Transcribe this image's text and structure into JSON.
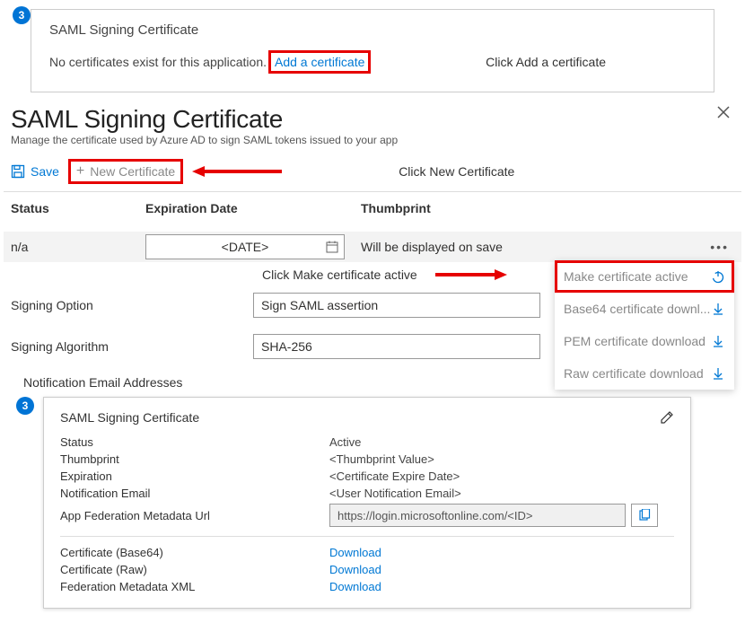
{
  "step_badge": "3",
  "panel1": {
    "title": "SAML Signing Certificate",
    "msg": "No certificates exist for this application.",
    "link": "Add a certificate",
    "instr": "Click Add a certificate"
  },
  "page": {
    "title": "SAML Signing Certificate",
    "subtitle": "Manage the certificate used by Azure AD to sign SAML tokens issued to your app"
  },
  "toolbar": {
    "save": "Save",
    "new_cert": "New Certificate",
    "instr": "Click New Certificate"
  },
  "table": {
    "h_status": "Status",
    "h_exp": "Expiration Date",
    "h_thumb": "Thumbprint",
    "row": {
      "status": "n/a",
      "date": "<DATE>",
      "thumb": "Will be displayed on save"
    }
  },
  "annot": {
    "make_active": "Click Make certificate active"
  },
  "menu": {
    "active": "Make certificate active",
    "b64": "Base64 certificate downl...",
    "pem": "PEM certificate download",
    "raw": "Raw certificate download"
  },
  "form": {
    "sign_option_label": "Signing Option",
    "sign_option_value": "Sign SAML assertion",
    "sign_alg_label": "Signing Algorithm",
    "sign_alg_value": "SHA-256"
  },
  "emails_heading": "Notification Email Addresses",
  "card": {
    "title": "SAML Signing Certificate",
    "status_k": "Status",
    "status_v": "Active",
    "thumb_k": "Thumbprint",
    "thumb_v": "<Thumbprint Value>",
    "exp_k": "Expiration",
    "exp_v": "<Certificate Expire Date>",
    "email_k": "Notification Email",
    "email_v": "<User Notification Email>",
    "meta_k": "App Federation Metadata Url",
    "meta_v": "https://login.microsoftonline.com/<ID>",
    "c64_k": "Certificate (Base64)",
    "craw_k": "Certificate (Raw)",
    "cxml_k": "Federation Metadata XML",
    "download": "Download"
  }
}
